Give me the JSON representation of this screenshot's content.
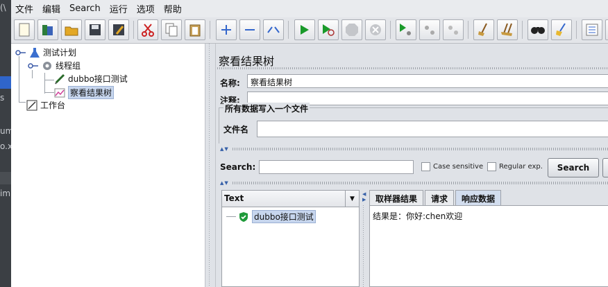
{
  "bg_strip": {
    "lines": [
      "(\\",
      "s",
      "um",
      "o.x",
      "im"
    ]
  },
  "menu": [
    "文件",
    "编辑",
    "Search",
    "运行",
    "选项",
    "帮助"
  ],
  "toolbar_icons": [
    "new-icon",
    "templates-icon",
    "open-icon",
    "save-icon",
    "save-as-icon",
    "cut-icon",
    "copy-icon",
    "paste-icon",
    "expand-icon",
    "collapse-icon",
    "toggle-icon",
    "start-icon",
    "start-no-pause-icon",
    "stop-icon",
    "shutdown-icon",
    "remote-start-icon",
    "remote-stop-icon",
    "remote-exit-icon",
    "clear-icon",
    "clear-all-icon",
    "search-icon",
    "reset-search-icon",
    "function-helper-icon",
    "help-icon"
  ],
  "tree": {
    "test_plan": "测试计划",
    "thread_group": "线程组",
    "sampler": "dubbo接口测试",
    "listener": "察看结果树",
    "workbench": "工作台"
  },
  "panel": {
    "title": "察看结果树",
    "name_label": "名称:",
    "name_value": "察看结果树",
    "comment_label": "注释:",
    "comment_value": "",
    "fieldset_legend": "所有数据写入一个文件",
    "filename_label": "文件名",
    "filename_value": ""
  },
  "search": {
    "label": "Search:",
    "value": "",
    "case_sensitive": "Case sensitive",
    "regex": "Regular exp.",
    "button": "Search"
  },
  "results": {
    "renderer": "Text",
    "items": [
      "dubbo接口测试"
    ],
    "tabs": [
      "取样器结果",
      "请求",
      "响应数据"
    ],
    "active_tab": 2,
    "response_text": "结果是：你好:chen欢迎"
  }
}
